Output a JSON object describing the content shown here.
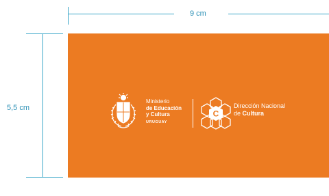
{
  "dimensions": {
    "width_label": "9 cm",
    "height_label": "5,5 cm"
  },
  "card": {
    "background_color": "#ec7b22",
    "ministry": {
      "line1": "Ministerio",
      "line2": "de Educación",
      "line3": "y Cultura",
      "country": "URUGUAY"
    },
    "direction": {
      "line1": "Dirección Nacional",
      "line2_prefix": "de ",
      "line2_bold": "Cultura"
    }
  },
  "icons": {
    "coat_of_arms": "coat-of-arms-icon",
    "cultura_logo": "cultura-hexagon-logo-icon"
  }
}
